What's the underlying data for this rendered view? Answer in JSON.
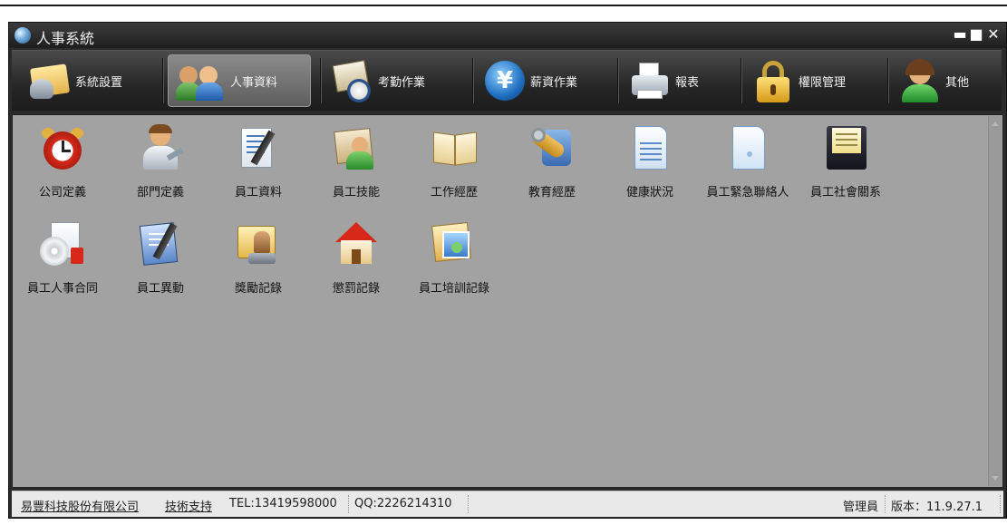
{
  "window": {
    "title": "人事系統"
  },
  "window_controls": {
    "minimize": "▬",
    "maximize": "■",
    "close": "✕"
  },
  "toolbar": [
    {
      "label": "系統設置",
      "icon": "settings-folder-icon",
      "active": false
    },
    {
      "label": "人事資料",
      "icon": "people-icon",
      "active": true
    },
    {
      "label": "考勤作業",
      "icon": "attendance-clock-icon",
      "active": false
    },
    {
      "label": "薪資作業",
      "icon": "yen-coin-icon",
      "active": false
    },
    {
      "label": "報表",
      "icon": "printer-icon",
      "active": false
    },
    {
      "label": "權限管理",
      "icon": "padlock-icon",
      "active": false
    },
    {
      "label": "其他",
      "icon": "support-agent-icon",
      "active": false
    }
  ],
  "items": [
    {
      "label": "公司定義",
      "icon": "alarm-clock-icon"
    },
    {
      "label": "部門定義",
      "icon": "department-people-icon"
    },
    {
      "label": "員工資料",
      "icon": "document-pen-icon"
    },
    {
      "label": "員工技能",
      "icon": "employee-skill-icon"
    },
    {
      "label": "工作經歷",
      "icon": "open-book-icon"
    },
    {
      "label": "教育經歷",
      "icon": "education-tools-icon"
    },
    {
      "label": "健康狀況",
      "icon": "health-document-icon"
    },
    {
      "label": "員工緊急聯絡人",
      "icon": "emergency-contact-icon"
    },
    {
      "label": "員工社會關系",
      "icon": "floppy-disk-icon"
    },
    {
      "label": "員工人事合同",
      "icon": "contract-cd-icon"
    },
    {
      "label": "員工異動",
      "icon": "transfer-document-icon"
    },
    {
      "label": "獎勵記錄",
      "icon": "reward-stamp-icon"
    },
    {
      "label": "懲罰記錄",
      "icon": "house-icon"
    },
    {
      "label": "員工培訓記錄",
      "icon": "photo-album-icon"
    }
  ],
  "statusbar": {
    "company": "易豐科技股份有限公司",
    "support": "技術支持",
    "tel": "TEL:13419598000",
    "qq": "QQ:2226214310",
    "user": "管理員",
    "version": "版本：11.9.27.1"
  },
  "colors": {
    "content_bg": "#a2a2a2",
    "toolbar_bg": "#2b2b2b",
    "status_bg": "#e9e9e9",
    "title_text": "#eaeaea"
  }
}
